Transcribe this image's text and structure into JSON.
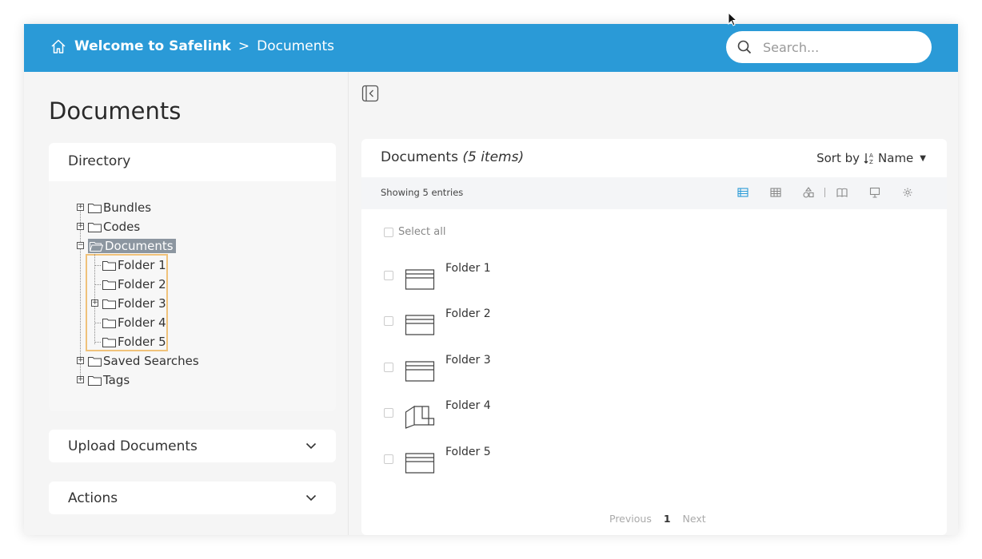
{
  "header": {
    "home_icon": "home-icon",
    "breadcrumb_root": "Welcome to Safelink",
    "breadcrumb_sep": ">",
    "breadcrumb_current": "Documents",
    "search_placeholder": "Search...",
    "search_icon": "search-icon",
    "bar_color": "#2a9ad7"
  },
  "sidebar": {
    "page_title": "Documents",
    "directory_title": "Directory",
    "tree": [
      {
        "label": "Bundles",
        "expander": "+"
      },
      {
        "label": "Codes",
        "expander": "+"
      },
      {
        "label": "Documents",
        "expander": "-",
        "selected": true
      },
      {
        "label": "Folder 1"
      },
      {
        "label": "Folder 2"
      },
      {
        "label": "Folder 3",
        "expander": "+"
      },
      {
        "label": "Folder 4"
      },
      {
        "label": "Folder 5"
      },
      {
        "label": "Saved Searches",
        "expander": "+"
      },
      {
        "label": "Tags",
        "expander": "+"
      }
    ],
    "upload_title": "Upload Documents",
    "actions_title": "Actions"
  },
  "main": {
    "title": "Documents",
    "count_label": "(5 items)",
    "sort_prefix": "Sort by",
    "sort_value": "Name",
    "showing": "Showing 5 entries",
    "select_all": "Select all",
    "items": [
      {
        "name": "Folder 1",
        "icon": "folder-icon"
      },
      {
        "name": "Folder 2",
        "icon": "folder-icon"
      },
      {
        "name": "Folder 3",
        "icon": "folder-icon"
      },
      {
        "name": "Folder 4",
        "icon": "open-folder-icon"
      },
      {
        "name": "Folder 5",
        "icon": "folder-icon"
      }
    ],
    "pager": {
      "previous": "Previous",
      "current": "1",
      "next": "Next"
    }
  }
}
